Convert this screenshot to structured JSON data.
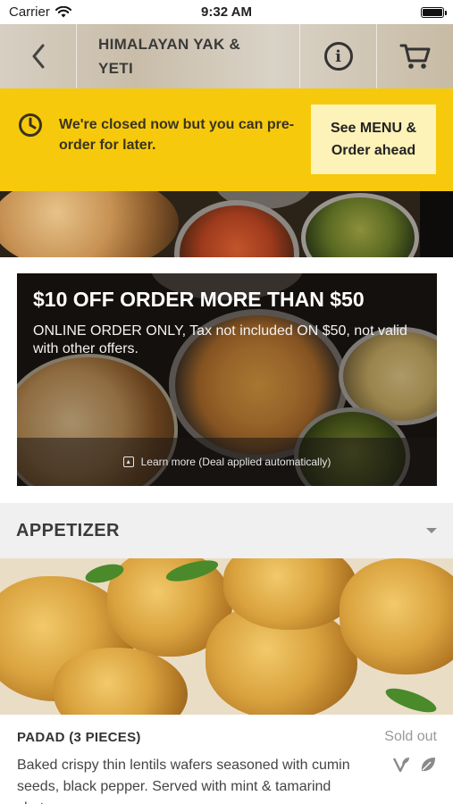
{
  "status_bar": {
    "carrier": "Carrier",
    "time": "9:32 AM"
  },
  "header": {
    "title_line1": "HIMALAYAN YAK &",
    "title_line2": "YETI"
  },
  "closed_banner": {
    "message": "We're closed now but you can pre-order for later.",
    "button_label": "See MENU & Order ahead"
  },
  "promo": {
    "title": "$10 OFF ORDER MORE THAN $50",
    "description": "ONLINE ORDER ONLY, Tax not included ON $50, not valid with other offers.",
    "learn_more": "Learn more (Deal applied automatically)"
  },
  "category": {
    "title": "APPETIZER"
  },
  "items": [
    {
      "name": "PADAD (3 PIECES)",
      "status": "Sold out",
      "description": "Baked crispy thin lentils wafers seasoned with cumin seeds, black pepper. Served with mint & tamarind chutney."
    }
  ],
  "colors": {
    "banner": "#f6c90c",
    "button": "#fdf2b8",
    "category_bg": "#f0f0f0"
  }
}
